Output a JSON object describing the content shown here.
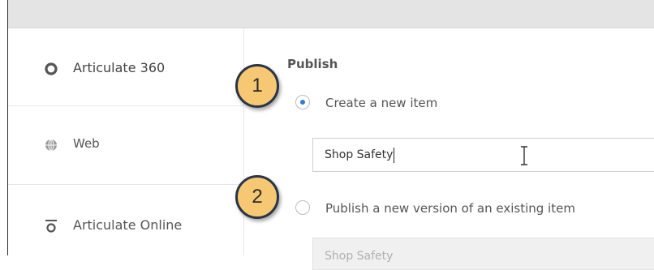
{
  "sidebar": {
    "items": [
      {
        "label": "Articulate 360",
        "icon": "articulate-360-icon"
      },
      {
        "label": "Web",
        "icon": "globe-icon"
      },
      {
        "label": "Articulate Online",
        "icon": "articulate-online-icon"
      }
    ]
  },
  "publish": {
    "title": "Publish",
    "options": [
      {
        "label": "Create a new item",
        "selected": true
      },
      {
        "label": "Publish a new version of an existing item",
        "selected": false
      }
    ],
    "item_name_value": "Shop Safety",
    "existing_item_value": "Shop Safety"
  },
  "callouts": [
    "1",
    "2"
  ],
  "colors": {
    "radio_selected": "#2f7fd0",
    "callout_fill": "#f7c873",
    "callout_border": "#2b3446"
  }
}
